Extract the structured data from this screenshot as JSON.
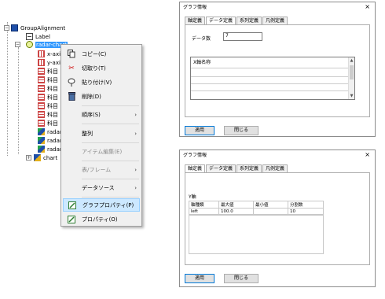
{
  "tree": {
    "root_label": "GroupAlignment",
    "label_node": "Label",
    "radar_node": "radar-chart",
    "axis_items": [
      "x-axis",
      "y-axis"
    ],
    "item_label": "科目",
    "data_label": "radar",
    "chart_label": "chart"
  },
  "context_menu": {
    "items": [
      {
        "label": "コピー(C)",
        "icon": "copy-icon"
      },
      {
        "label": "切取り(T)",
        "icon": "scissors-icon"
      },
      {
        "label": "貼り付け(V)",
        "icon": "paste-icon"
      },
      {
        "label": "削除(D)",
        "icon": "trash-icon"
      },
      {
        "label": "順序(S)",
        "submenu": true
      },
      {
        "label": "整列",
        "submenu": true
      },
      {
        "label": "アイテム編集(E)",
        "disabled": true
      },
      {
        "label": "表/フレーム",
        "submenu": true,
        "disabled": true
      },
      {
        "label": "データソース",
        "submenu": true
      },
      {
        "label": "グラフプロパティ(P)",
        "icon": "edit-icon",
        "highlighted": true
      },
      {
        "label": "プロパティ(O)",
        "icon": "edit-icon"
      }
    ]
  },
  "dialog_top": {
    "title": "グラフ情報",
    "close": "×",
    "tabs": [
      "軸定義",
      "データ定義",
      "系列定義",
      "凡例定義"
    ],
    "active_tab": 1,
    "data_count_label": "データ数",
    "data_count_value": "7",
    "x_axis_name_header": "X軸名称",
    "apply_label": "適用",
    "close_label": "閉じる"
  },
  "dialog_bottom": {
    "title": "グラフ情報",
    "close": "×",
    "tabs": [
      "軸定義",
      "データ定義",
      "系列定義",
      "凡例定義"
    ],
    "active_tab": 0,
    "y_axis_label": "Y軸",
    "columns": [
      "軸種類",
      "最大値",
      "最小値",
      "分割数"
    ],
    "rows": [
      [
        "left",
        "100.0",
        "",
        "10"
      ]
    ],
    "apply_label": "適用",
    "close_label": "閉じる"
  }
}
